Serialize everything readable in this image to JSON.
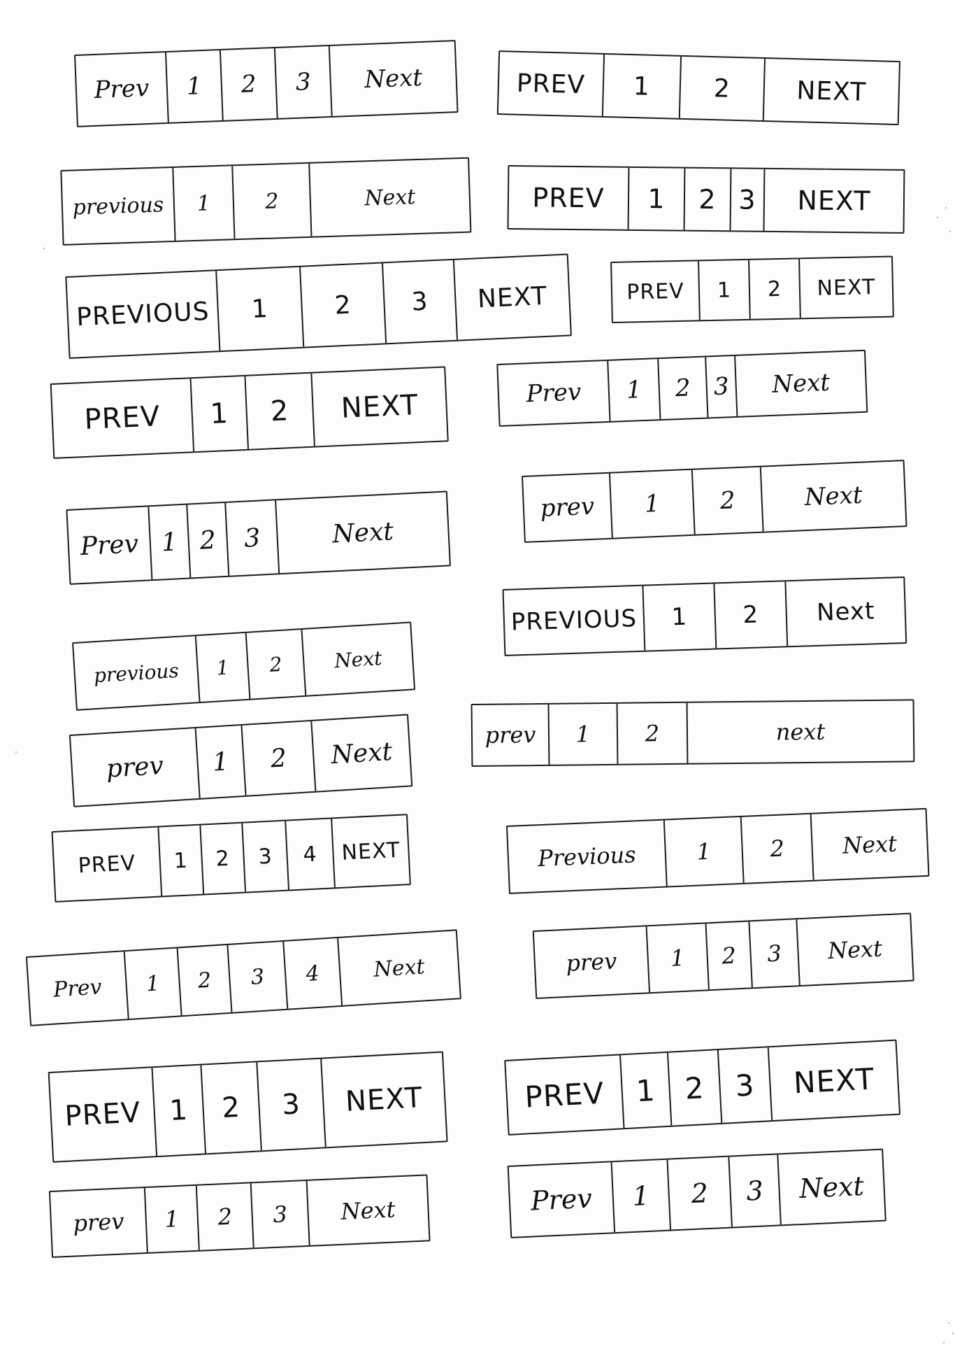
{
  "paginations": [
    {
      "prev": "Prev",
      "pages": [
        "1",
        "2",
        "3"
      ],
      "next": "Next"
    },
    {
      "prev": "PREV",
      "pages": [
        "1",
        "2"
      ],
      "next": "NEXT"
    },
    {
      "prev": "previous",
      "pages": [
        "1",
        "2"
      ],
      "next": "Next"
    },
    {
      "prev": "PREV",
      "pages": [
        "1",
        "2",
        "3"
      ],
      "next": "NEXT"
    },
    {
      "prev": "PREVIOUS",
      "pages": [
        "1",
        "2",
        "3"
      ],
      "next": "NEXT"
    },
    {
      "prev": "PREV",
      "pages": [
        "1",
        "2"
      ],
      "next": "NEXT"
    },
    {
      "prev": "PREV",
      "pages": [
        "1",
        "2"
      ],
      "next": "NEXT"
    },
    {
      "prev": "Prev",
      "pages": [
        "1",
        "2",
        "3"
      ],
      "next": "Next"
    },
    {
      "prev": "Prev",
      "pages": [
        "1",
        "2",
        "3"
      ],
      "next": "Next"
    },
    {
      "prev": "prev",
      "pages": [
        "1",
        "2"
      ],
      "next": "Next"
    },
    {
      "prev": "previous",
      "pages": [
        "1",
        "2"
      ],
      "next": "Next"
    },
    {
      "prev": "PREVIOUS",
      "pages": [
        "1",
        "2"
      ],
      "next": "Next"
    },
    {
      "prev": "prev",
      "pages": [
        "1",
        "2"
      ],
      "next": "Next"
    },
    {
      "prev": "prev",
      "pages": [
        "1",
        "2"
      ],
      "next": "next"
    },
    {
      "prev": "PREV",
      "pages": [
        "1",
        "2",
        "3",
        "4"
      ],
      "next": "NEXT"
    },
    {
      "prev": "Previous",
      "pages": [
        "1",
        "2"
      ],
      "next": "Next"
    },
    {
      "prev": "Prev",
      "pages": [
        "1",
        "2",
        "3",
        "4"
      ],
      "next": "Next"
    },
    {
      "prev": "prev",
      "pages": [
        "1",
        "2",
        "3"
      ],
      "next": "Next"
    },
    {
      "prev": "PREV",
      "pages": [
        "1",
        "2",
        "3"
      ],
      "next": "NEXT"
    },
    {
      "prev": "PREV",
      "pages": [
        "1",
        "2",
        "3"
      ],
      "next": "NEXT"
    },
    {
      "prev": "prev",
      "pages": [
        "1",
        "2",
        "3"
      ],
      "next": "Next"
    },
    {
      "prev": "Prev",
      "pages": [
        "1",
        "2",
        "3"
      ],
      "next": "Next"
    }
  ]
}
